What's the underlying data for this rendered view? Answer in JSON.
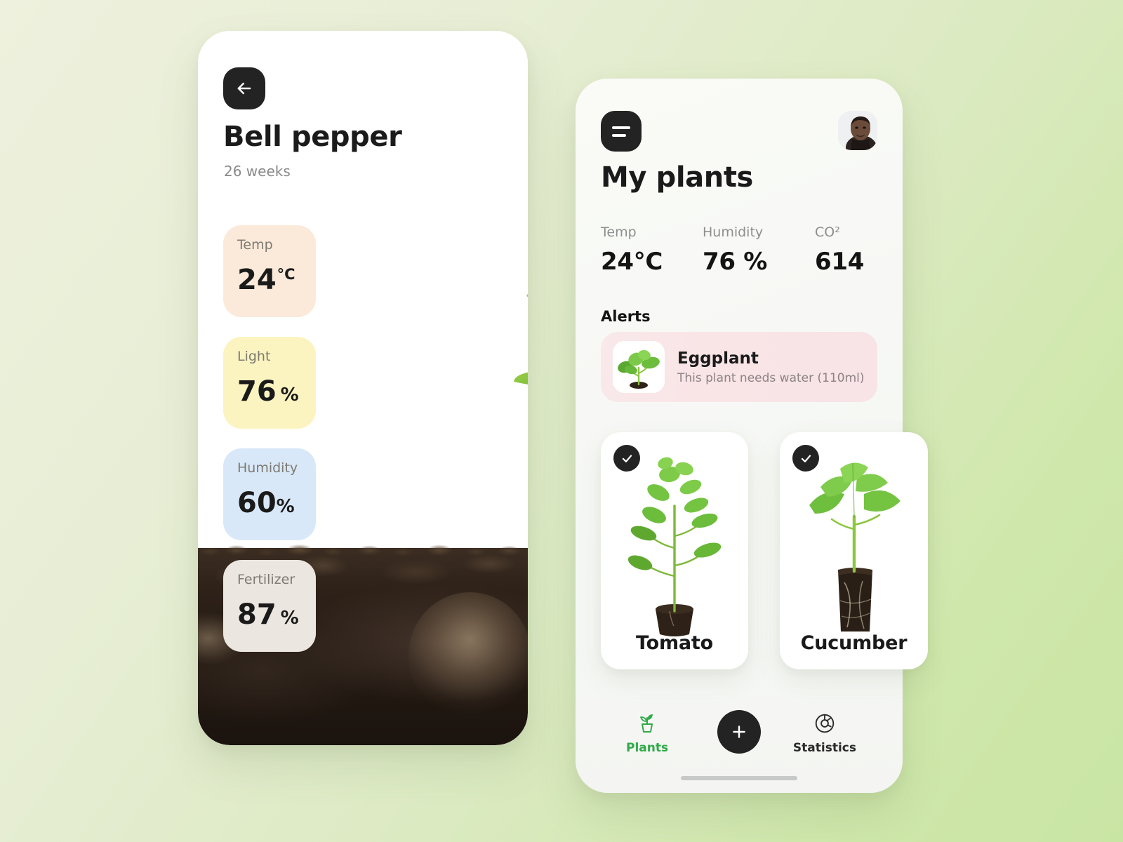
{
  "theme": {
    "background_gradient_from": "#eef1dd",
    "background_gradient_to": "#c9e5a4",
    "dark": "#232323",
    "accent_green": "#2faa48",
    "card_temp_bg": "#fbead9",
    "card_light_bg": "#fbf4c0",
    "card_humidity_bg": "#d9e8f8",
    "card_fertilizer_bg": "#ebe6df",
    "alert_bg": "#f9e4e6"
  },
  "plant_detail_screen": {
    "back_icon": "arrow-left-icon",
    "title": "Bell pepper",
    "age": "26 weeks",
    "metrics": [
      {
        "label": "Temp",
        "value": "24",
        "unit": "°C"
      },
      {
        "label": "Light",
        "value": "76",
        "unit": "%"
      },
      {
        "label": "Humidity",
        "value": "60",
        "unit": "%"
      },
      {
        "label": "Fertilizer",
        "value": "87",
        "unit": "%"
      }
    ]
  },
  "my_plants_screen": {
    "menu_icon": "hamburger-menu-icon",
    "avatar_icon": "user-avatar",
    "title": "My plants",
    "stats": [
      {
        "label": "Temp",
        "value": "24°C"
      },
      {
        "label": "Humidity",
        "value": "76 %"
      },
      {
        "label": "CO²",
        "value": "614"
      }
    ],
    "alerts_heading": "Alerts",
    "alerts": [
      {
        "thumb_icon": "eggplant-seedling-thumbnail",
        "title": "Eggplant",
        "description": "This plant needs water (110ml)"
      }
    ],
    "plant_cards": [
      {
        "name": "Tomato",
        "checked": true,
        "check_icon": "check-circle-icon",
        "art": "tomato-seedling-photo"
      },
      {
        "name": "Cucumber",
        "checked": true,
        "check_icon": "check-circle-icon",
        "art": "cucumber-seedling-photo"
      }
    ],
    "bottom_nav": {
      "items": [
        {
          "label": "Plants",
          "icon": "potted-plant-icon",
          "active": true
        },
        {
          "label": "Statistics",
          "icon": "donut-chart-icon",
          "active": false
        }
      ],
      "fab_icon": "plus-icon",
      "home_indicator": "home-indicator-bar"
    }
  }
}
